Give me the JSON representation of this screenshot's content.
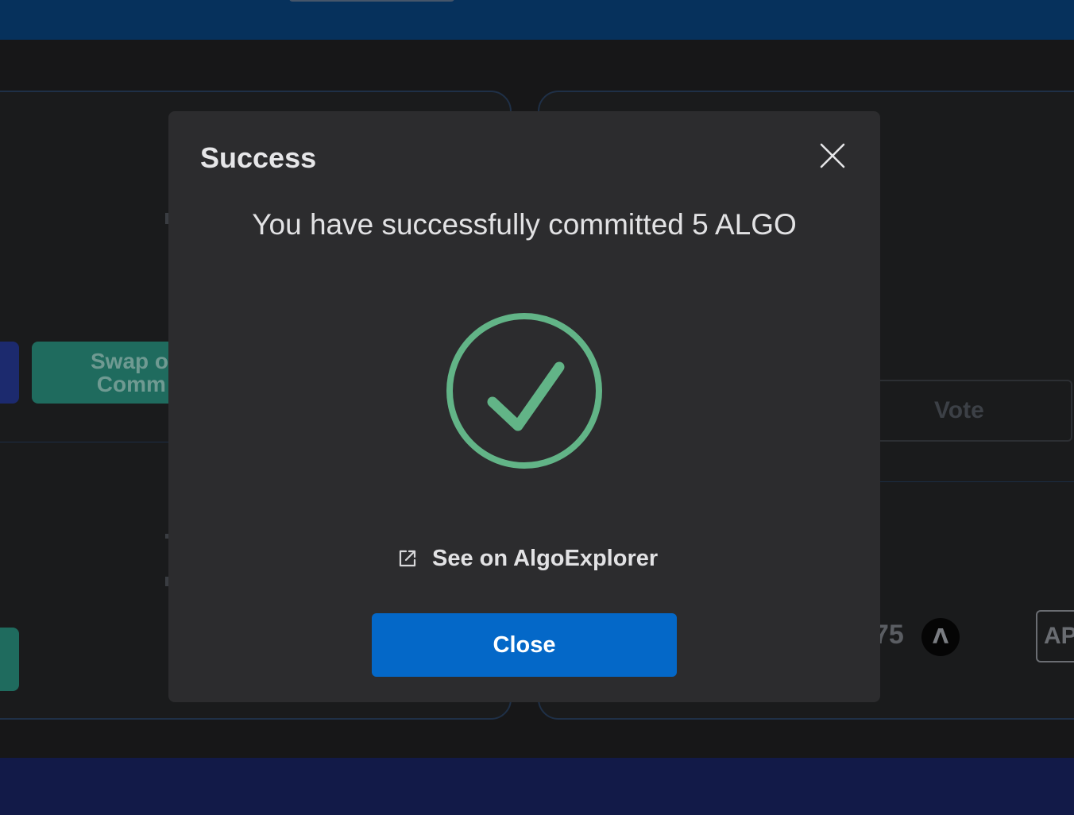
{
  "background": {
    "swap_button_label": "Swap o\n Comm",
    "vote_button_label": "Vote",
    "amount_fragment": "75",
    "algo_badge_glyph": "Λ",
    "ap_button_label": "AP"
  },
  "modal": {
    "title": "Success",
    "message": "You have successfully committed 5 ALGO",
    "explorer_link_label": "See on AlgoExplorer",
    "close_button_label": "Close",
    "icons": {
      "close": "close-icon",
      "success": "check-circle-icon",
      "external_link": "external-link-icon"
    },
    "colors": {
      "success": "#62b487",
      "primary_button": "#0468c8",
      "modal_bg": "#2c2c2e"
    }
  }
}
